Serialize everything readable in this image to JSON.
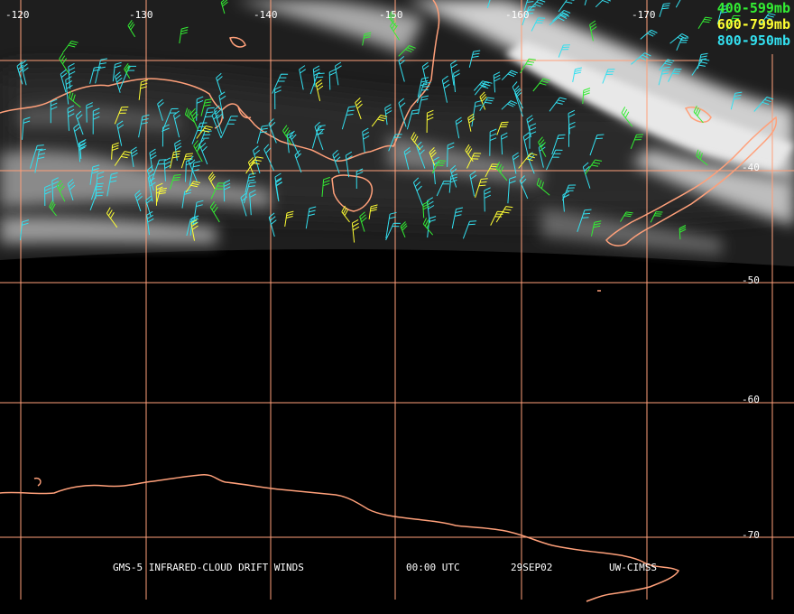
{
  "map": {
    "longitude_labels": [
      "-120",
      "-130",
      "-140",
      "-150",
      "-160",
      "-170"
    ],
    "latitude_labels": [
      "-40",
      "-50",
      "-60",
      "-70"
    ],
    "colors": {
      "background": "#000000",
      "grid": "#ffa07a",
      "coastline": "#ffa07a",
      "cloud": "#d8d8d8",
      "label": "#ffffff"
    }
  },
  "legend": [
    {
      "label": "400-599mb",
      "color": "#33ee33",
      "series": "green"
    },
    {
      "label": "600-799mb",
      "color": "#ffff33",
      "series": "yellow"
    },
    {
      "label": "800-950mb",
      "color": "#33e0f0",
      "series": "cyan"
    }
  ],
  "footer": {
    "product": "GMS-5 INFRARED-CLOUD DRIFT WINDS",
    "time": "00:00 UTC",
    "date": "29SEP02",
    "source": "UW-CIMSS"
  }
}
